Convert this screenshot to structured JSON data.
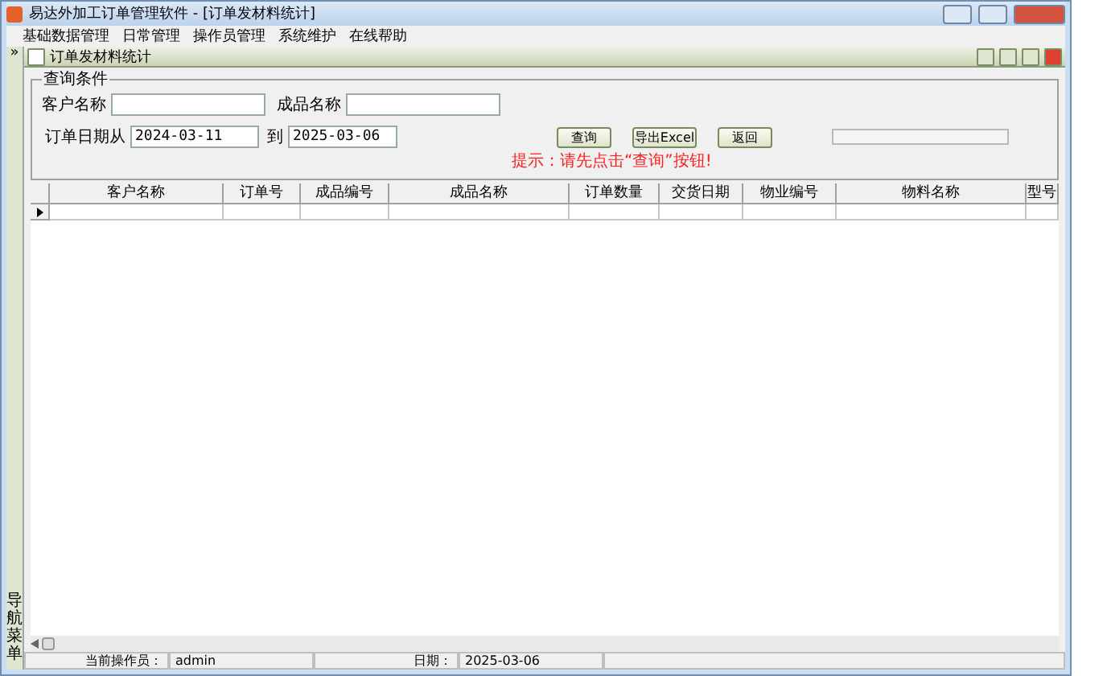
{
  "window": {
    "title": "易达外加工订单管理软件  - [订单发材料统计]"
  },
  "menu": [
    "基础数据管理",
    "日常管理",
    "操作员管理",
    "系统维护",
    "在线帮助"
  ],
  "nav": {
    "toggle": "»",
    "label": "导航菜单"
  },
  "child_window": {
    "title": "订单发材料统计"
  },
  "query": {
    "legend": "查询条件",
    "fields": [
      {
        "label": "客户名称"
      },
      {
        "label": "成品名称"
      }
    ],
    "date_from": {
      "label": "订单日期从",
      "value": "2024-03-11"
    },
    "date_to": {
      "label": "到",
      "value": "2025-03-06"
    },
    "buttons": [
      "查询",
      "导出Excel",
      "返回"
    ],
    "progress": {
      "level": 0
    },
    "hint": "提示：请先点击“查询”按钮!"
  },
  "table": {
    "columns": [
      "客户名称",
      "订单号",
      "成品编号",
      "成品名称",
      "订单数量",
      "交货日期",
      "物业编号",
      "物料名称",
      "型号"
    ],
    "rows": [
      {
        "current": true
      }
    ]
  },
  "status_bar": [
    {
      "label": "当前操作员：",
      "value": "admin"
    },
    {
      "label": "日期：",
      "value": "2025-03-06"
    }
  ]
}
